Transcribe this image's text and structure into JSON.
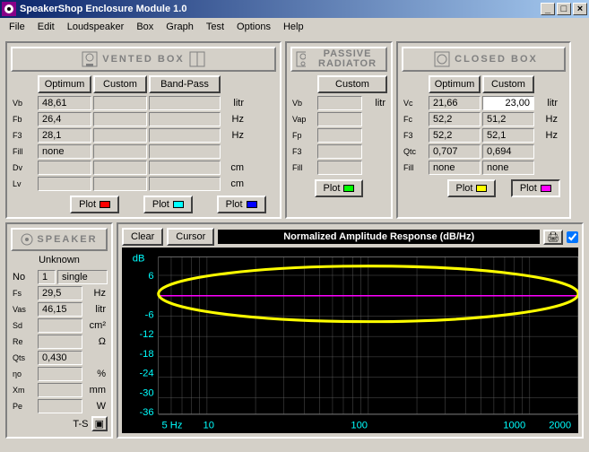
{
  "window": {
    "title": "SpeakerShop Enclosure Module 1.0",
    "min": "_",
    "max": "□",
    "close": "×"
  },
  "menu": [
    "File",
    "Edit",
    "Loudspeaker",
    "Box",
    "Graph",
    "Test",
    "Options",
    "Help"
  ],
  "panels": {
    "vented": {
      "title": "VENTED BOX",
      "btn_optimum": "Optimum",
      "btn_custom": "Custom",
      "btn_bandpass": "Band-Pass",
      "rows": [
        {
          "k": "Vb",
          "v": "48,61",
          "u": "litr"
        },
        {
          "k": "Fb",
          "v": "26,4",
          "u": "Hz"
        },
        {
          "k": "F3",
          "v": "28,1",
          "u": "Hz"
        },
        {
          "k": "Fill",
          "v": "none",
          "u": ""
        },
        {
          "k": "Dv",
          "v": "",
          "u": "cm"
        },
        {
          "k": "Lv",
          "v": "",
          "u": "cm"
        }
      ],
      "plot": "Plot"
    },
    "passive": {
      "title": "PASSIVE RADIATOR",
      "btn_custom": "Custom",
      "rows": [
        {
          "k": "Vb",
          "v": "",
          "u": "litr"
        },
        {
          "k": "Vap",
          "v": "",
          "u": ""
        },
        {
          "k": "Fp",
          "v": "",
          "u": ""
        },
        {
          "k": "F3",
          "v": "",
          "u": ""
        },
        {
          "k": "Fill",
          "v": "",
          "u": ""
        }
      ],
      "plot": "Plot"
    },
    "closed": {
      "title": "CLOSED BOX",
      "btn_optimum": "Optimum",
      "btn_custom": "Custom",
      "rows": [
        {
          "k": "Vc",
          "o": "21,66",
          "c": "23,00",
          "u": "litr"
        },
        {
          "k": "Fc",
          "o": "52,2",
          "c": "51,2",
          "u": "Hz"
        },
        {
          "k": "F3",
          "o": "52,2",
          "c": "52,1",
          "u": "Hz"
        },
        {
          "k": "Qtc",
          "o": "0,707",
          "c": "0,694",
          "u": ""
        },
        {
          "k": "Fill",
          "o": "none",
          "c": "none",
          "u": ""
        }
      ],
      "plot": "Plot"
    }
  },
  "speaker": {
    "title": "SPEAKER",
    "name": "Unknown",
    "no_lbl": "No",
    "no_val": "1",
    "config": "single",
    "rows": [
      {
        "k": "Fs",
        "v": "29,5",
        "u": "Hz"
      },
      {
        "k": "Vas",
        "v": "46,15",
        "u": "litr"
      },
      {
        "k": "Sd",
        "v": "",
        "u": "cm²"
      },
      {
        "k": "Re",
        "v": "",
        "u": "Ω"
      },
      {
        "k": "Qts",
        "v": "0,430",
        "u": ""
      },
      {
        "k": "ηo",
        "v": "",
        "u": "%"
      },
      {
        "k": "Xm",
        "v": "",
        "u": "mm"
      },
      {
        "k": "Pe",
        "v": "",
        "u": "W"
      }
    ],
    "ts": "T-S"
  },
  "chart": {
    "btn_clear": "Clear",
    "btn_cursor": "Cursor",
    "title": "Normalized Amplitude Response (dB/Hz)",
    "ylabel": "dB",
    "yticks": [
      "6",
      "",
      "-6",
      "-12",
      "-18",
      "-24",
      "-30",
      "-36"
    ],
    "xticks": [
      "5 Hz",
      "10",
      "100",
      "1000",
      "2000"
    ]
  },
  "chart_data": {
    "type": "line",
    "title": "Normalized Amplitude Response (dB/Hz)",
    "xlabel": "Hz",
    "ylabel": "dB",
    "xscale": "log",
    "xlim": [
      5,
      2000
    ],
    "ylim": [
      -36,
      6
    ],
    "series": [
      {
        "name": "Closed Box (Custom)",
        "color": "#ff00ff",
        "x": [
          5,
          10,
          20,
          30,
          40,
          50,
          60,
          80,
          100,
          200,
          500,
          1000,
          2000
        ],
        "values": [
          0,
          0,
          0,
          0,
          0,
          0,
          0,
          0,
          0,
          0,
          0,
          0,
          0
        ]
      }
    ],
    "annotations": [
      {
        "type": "ellipse",
        "color": "#ffff00",
        "x_range": [
          5,
          2000
        ],
        "y_range": [
          -6,
          6
        ]
      }
    ]
  },
  "colors": {
    "vented_opt": "#ff0000",
    "vented_cus": "#00ffff",
    "vented_bp": "#0000ff",
    "passive": "#00ff00",
    "closed_opt": "#ffff00",
    "closed_cus": "#ff00ff"
  }
}
